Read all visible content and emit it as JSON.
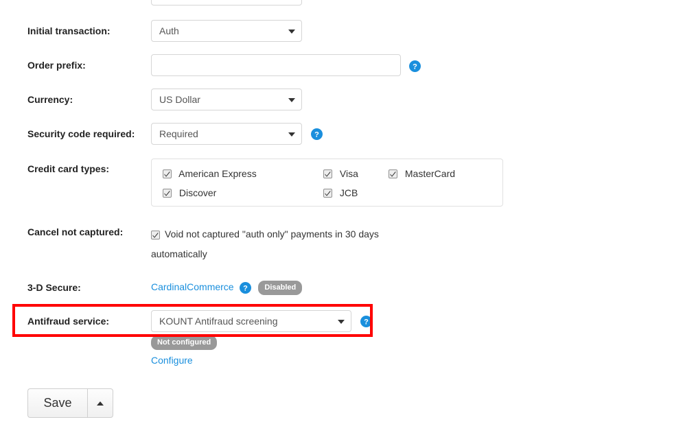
{
  "form": {
    "rows": [
      {
        "id": "initial-transaction",
        "label": "Initial transaction:",
        "control": "select",
        "value": "Auth"
      },
      {
        "id": "order-prefix",
        "label": "Order prefix:",
        "control": "text",
        "value": "",
        "placeholder": "",
        "help_icon": "help-circle-icon"
      },
      {
        "id": "currency",
        "label": "Currency:",
        "control": "select",
        "value": "US Dollar"
      },
      {
        "id": "security-code-required",
        "label": "Security code required:",
        "control": "select",
        "value": "Required",
        "help_icon": "help-circle-icon"
      },
      {
        "id": "credit-card-types",
        "label": "Credit card types:",
        "control": "checkbox-group"
      },
      {
        "id": "cancel-not-captured",
        "label": "Cancel not captured:",
        "control": "checkbox"
      },
      {
        "id": "three-d-secure",
        "label": "3-D Secure:",
        "control": "link-badge"
      },
      {
        "id": "antifraud-service",
        "label": "Antifraud service:",
        "control": "select",
        "value": "KOUNT Antifraud screening",
        "help_icon": "help-circle-icon"
      }
    ],
    "credit_card_types": {
      "items": [
        {
          "label": "American Express",
          "checked": true
        },
        {
          "label": "Visa",
          "checked": true
        },
        {
          "label": "MasterCard",
          "checked": true
        },
        {
          "label": "Discover",
          "checked": true
        },
        {
          "label": "JCB",
          "checked": true
        }
      ]
    },
    "cancel_not_captured": {
      "checked": true,
      "text_line1": "Void not captured \"auth only\" payments in 30 days",
      "text_line2": "automatically"
    },
    "three_d_secure": {
      "provider_link": "CardinalCommerce",
      "help_icon": "help-circle-icon",
      "status_badge": "Disabled"
    },
    "antifraud": {
      "status_badge": "Not configured",
      "configure_link": "Configure"
    }
  },
  "actions": {
    "save_label": "Save",
    "split_toggle_icon": "caret-up-icon"
  },
  "colors": {
    "accent_blue": "#1a8fdd",
    "badge_gray": "#999999",
    "highlight_red": "#ff0000",
    "border_gray": "#d5d5d5"
  }
}
